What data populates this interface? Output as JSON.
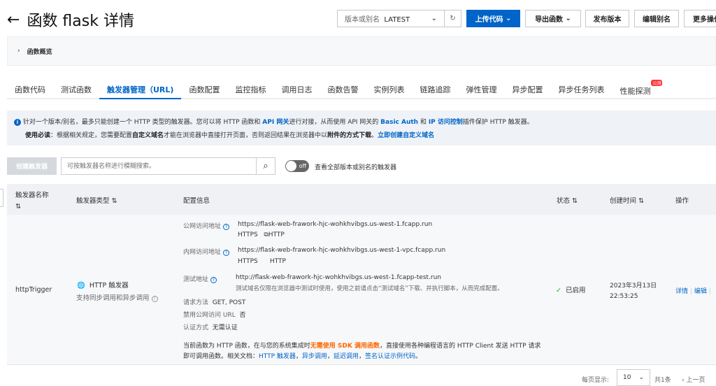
{
  "header": {
    "back_icon": "arrow-left-icon",
    "title": "函数 flask 详情",
    "version_label": "版本或别名",
    "version_value": "LATEST",
    "upload_code": "上传代码",
    "export_function": "导出函数",
    "publish_version": "发布版本",
    "edit_alias": "编辑别名",
    "more_actions": "更多操作"
  },
  "overview": {
    "label": "函数概览"
  },
  "tabs": [
    {
      "label": "函数代码"
    },
    {
      "label": "测试函数"
    },
    {
      "label": "触发器管理（URL)"
    },
    {
      "label": "函数配置"
    },
    {
      "label": "监控指标"
    },
    {
      "label": "调用日志"
    },
    {
      "label": "函数告警"
    },
    {
      "label": "实例列表"
    },
    {
      "label": "链路追踪"
    },
    {
      "label": "弹性管理"
    },
    {
      "label": "异步配置"
    },
    {
      "label": "异步任务列表"
    },
    {
      "label": "性能探测",
      "badge": "公测"
    }
  ],
  "notice": {
    "l1a": "针对一个版本/别名，最多只能创建一个 HTTP 类型的触发器。您可以将 HTTP 函数和 ",
    "l1b": "API 网关",
    "l1c": "进行对接，从而使用 API 网关的 ",
    "l1d": "Basic Auth",
    "l1e": " 和 ",
    "l1f": "IP 访问控制",
    "l1g": "插件保护 HTTP 触发器。",
    "l2a": "使用必读",
    "l2b": "：根据相关规定，您需要配置",
    "l2c": "自定义域名",
    "l2d": "才能在浏览器中直接打开页面，否则返回结果在浏览器中以",
    "l2e": "附件的方式下载",
    "l2f": "。",
    "l2g": "立即创建自定义域名"
  },
  "toolbar": {
    "create": "创建触发器",
    "search_placeholder": "可按触发器名称进行模糊搜索。",
    "toggle": "off",
    "toggle_label": "查看全部版本或别名的触发器"
  },
  "table": {
    "headers": [
      "触发器名称",
      "触发器类型",
      "配置信息",
      "状态",
      "创建时间",
      "操作"
    ],
    "row": {
      "name": "httpTrigger",
      "type": "HTTP 触发器",
      "type_sub": "支持同步调用和异步调用",
      "public_label": "公网访问地址",
      "public_url": "https://flask-web-frawork-hjc-wohkhvibgs.us-west-1.fcapp.run",
      "https": "HTTPS",
      "http": "HTTP",
      "internal_label": "内网访问地址",
      "internal_url": "https://flask-web-frawork-hjc-wohkhvibgs.us-west-1-vpc.fcapp.run",
      "test_label": "测试地址",
      "test_url": "http://flask-web-frawork-hjc-wohkhvibgs.us-west-1.fcapp-test.run",
      "test_note": "测试域名仅限在浏览器中测试时使用，使用之前请点击“测试域名”下载、并执行脚本，从而完成配置。",
      "method_label": "请求方法",
      "method": "GET, POST",
      "disable_label": "禁用公网访问 URL",
      "disable": "否",
      "auth_label": "认证方式",
      "auth": "无需认证",
      "desc_a": "当前函数为 HTTP 函数，在与您的系统集成时",
      "desc_b": "无需使用 SDK 调用函数",
      "desc_c": "，直接使用各种编程语言的 HTTP Client 发送 HTTP 请求",
      "desc_d": "即可调用函数。相关文档：",
      "doc1": "HTTP 触发器",
      "doc2": "异步调用",
      "doc3": "延迟调用",
      "doc4": "签名认证示例代码",
      "sep": "，",
      "end": "。",
      "status": "已启用",
      "created_date": "2023年3月13日",
      "created_time": "22:53:25",
      "detail": "详情",
      "edit": "编辑"
    }
  },
  "pagination": {
    "per_page_label": "每页显示:",
    "per_page": "10",
    "total": "共1条",
    "prev": "上一页"
  }
}
